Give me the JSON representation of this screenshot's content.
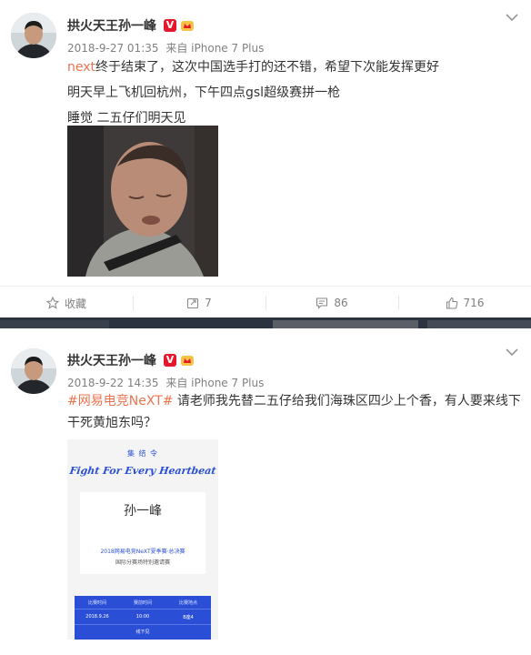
{
  "posts": [
    {
      "author": "拱火天王孙一峰",
      "verified_badge": "V",
      "date": "2018-9-27 01:35",
      "source_prefix": "来自",
      "device": "iPhone 7 Plus",
      "lines": [
        {
          "highlight": "next",
          "rest": "终于结束了，这次中国选手打的还不错，希望下次能发挥更好"
        },
        {
          "text": "明天早上飞机回杭州，下午四点gsl超级赛拼一枪"
        },
        {
          "text": "睡觉 二五仔们明天见"
        }
      ],
      "actions": {
        "favorite": "收藏",
        "repost": "7",
        "comment": "86",
        "like": "716"
      }
    },
    {
      "author": "拱火天王孙一峰",
      "verified_badge": "V",
      "date": "2018-9-22 14:35",
      "source_prefix": "来自",
      "device": "iPhone 7 Plus",
      "hashtag": "#网易电竞NeXT#",
      "text_line1": " 请老师我先替二五仔给我们海珠区四少上个香，有人要来线下",
      "text_line2": "干死黄旭东吗？",
      "invite": {
        "header": "集 结 令",
        "slogan": "Fight For Every Heartbeat",
        "name": "孙一峰",
        "event": "2018网易电竞NeXT夏季赛·总决赛",
        "subtitle": "国际分赛场特别邀请赛",
        "table_headers": [
          "比赛时间",
          "赛前时间",
          "比赛地点"
        ],
        "table_values": [
          "2018.9.26",
          "10:00",
          "B座4"
        ],
        "footer": "线下见"
      }
    }
  ],
  "icons": [
    "avatar",
    "verified-icon",
    "crown-icon",
    "chevron-down-icon",
    "star-icon",
    "repost-icon",
    "comment-icon",
    "like-icon"
  ],
  "colors": {
    "link": "#eb7350",
    "meta": "#808080",
    "verified": "#e6162d",
    "invite_blue": "#2a4fd6"
  }
}
